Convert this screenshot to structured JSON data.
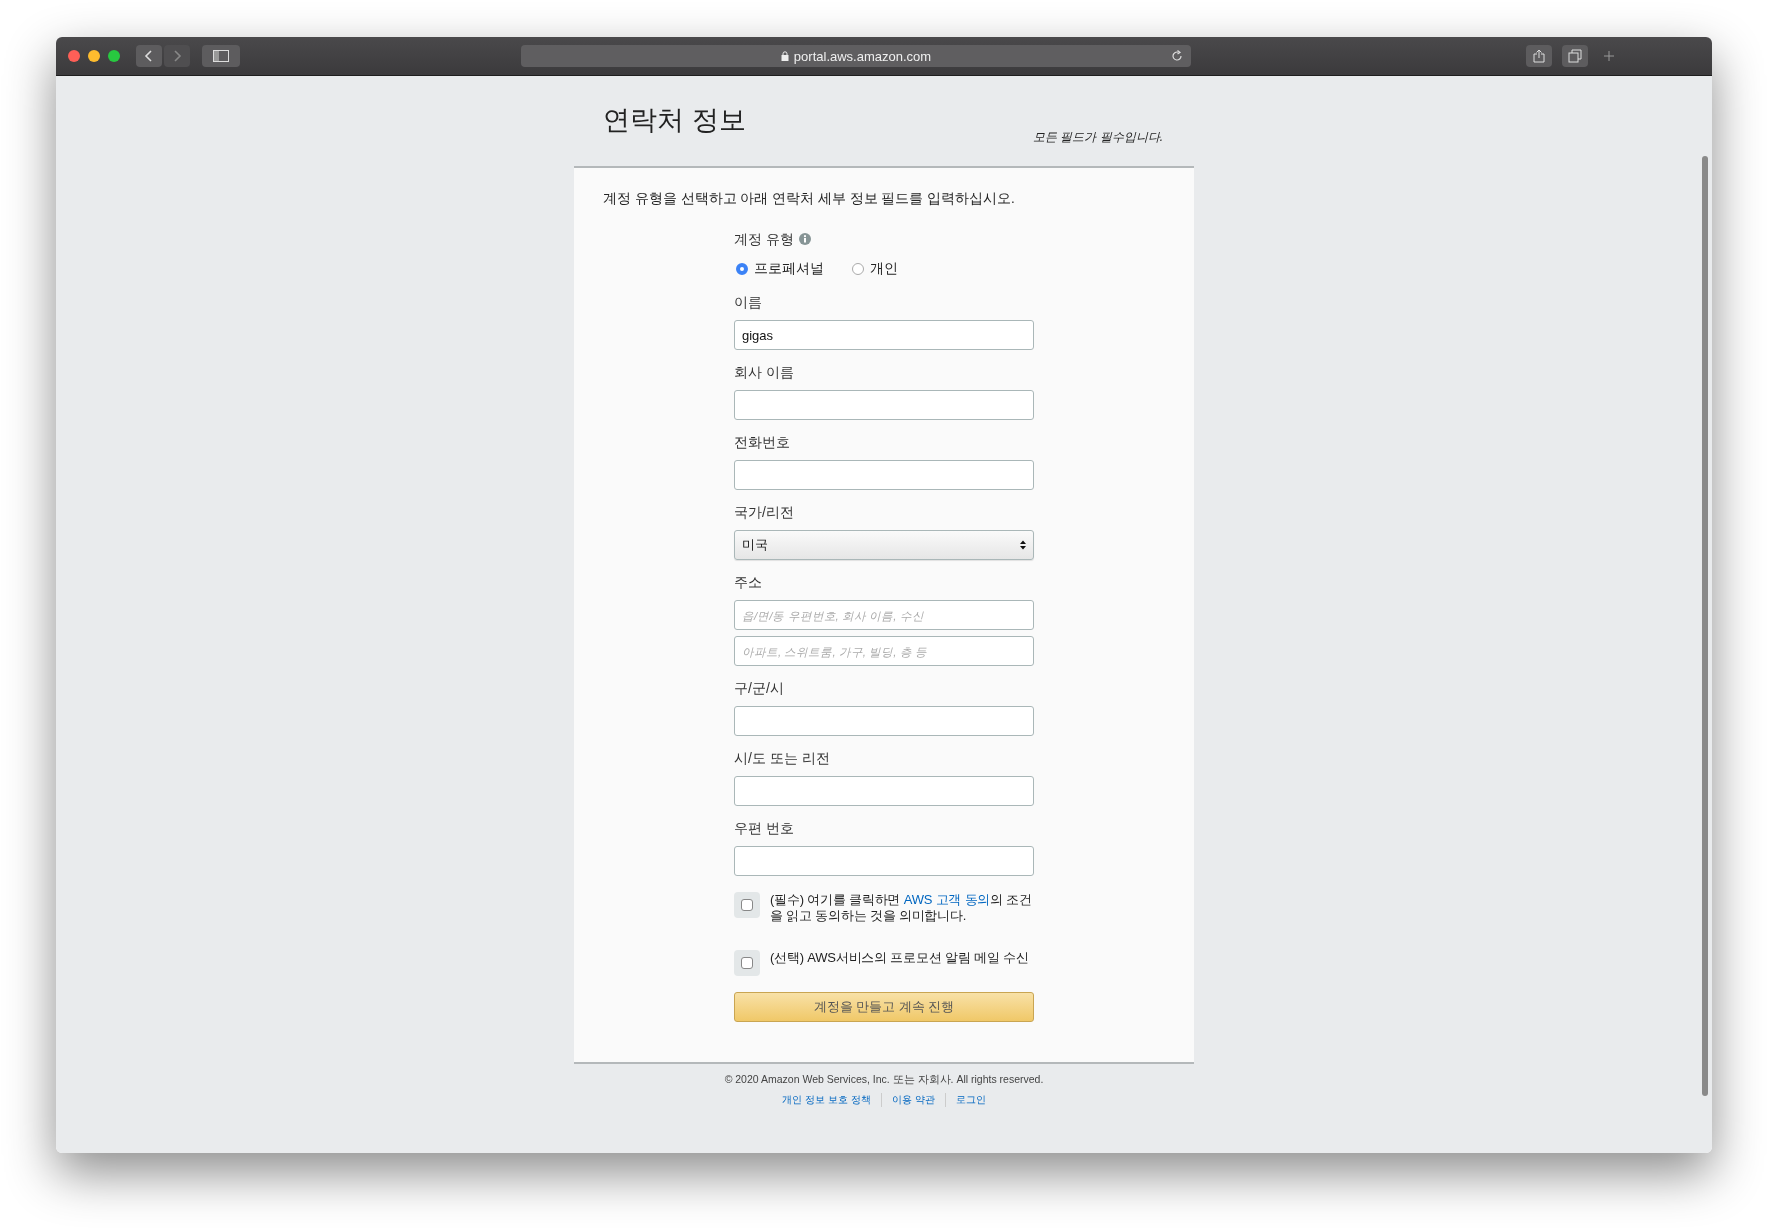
{
  "browser": {
    "url": "portal.aws.amazon.com"
  },
  "page": {
    "title": "연락처 정보",
    "required_note": "모든 필드가 필수입니다.",
    "intro": "계정 유형을 선택하고 아래 연락처 세부 정보 필드를 입력하십시오.",
    "account_type": {
      "label": "계정 유형",
      "options": [
        {
          "label": "프로페셔널",
          "selected": true
        },
        {
          "label": "개인",
          "selected": false
        }
      ]
    },
    "fields": [
      {
        "label": "이름",
        "kind": "text",
        "value": "gigas"
      },
      {
        "label": "회사 이름",
        "kind": "text"
      },
      {
        "label": "전화번호",
        "kind": "text"
      },
      {
        "label": "국가/리전",
        "kind": "select",
        "value": "미국"
      },
      {
        "label": "주소",
        "kind": "text",
        "placeholders": [
          "읍/면/동 우편번호, 회사 이름, 수신",
          "아파트, 스위트룸, 가구, 빌딩, 층 등"
        ]
      },
      {
        "label": "구/군/시",
        "kind": "text"
      },
      {
        "label": "시/도 또는 리전",
        "kind": "text"
      },
      {
        "label": "우편 번호",
        "kind": "text"
      }
    ],
    "agreements": [
      {
        "checked": false,
        "text_before": "(필수) 여기를 클릭하면 ",
        "link": "AWS 고객 동의",
        "text_after": "의 조건을 읽고 동의하는 것을 의미합니다."
      },
      {
        "checked": false,
        "text_before": "(선택) AWS서비스의 프로모션 알림 메일 수신"
      }
    ],
    "submit": "계정을 만들고 계속 진행"
  },
  "footer": {
    "copyright": "© 2020 Amazon Web Services, Inc. 또는 자회사. All rights reserved.",
    "links": [
      "개인 정보 보호 정책",
      "이용 약관",
      "로그인"
    ]
  }
}
